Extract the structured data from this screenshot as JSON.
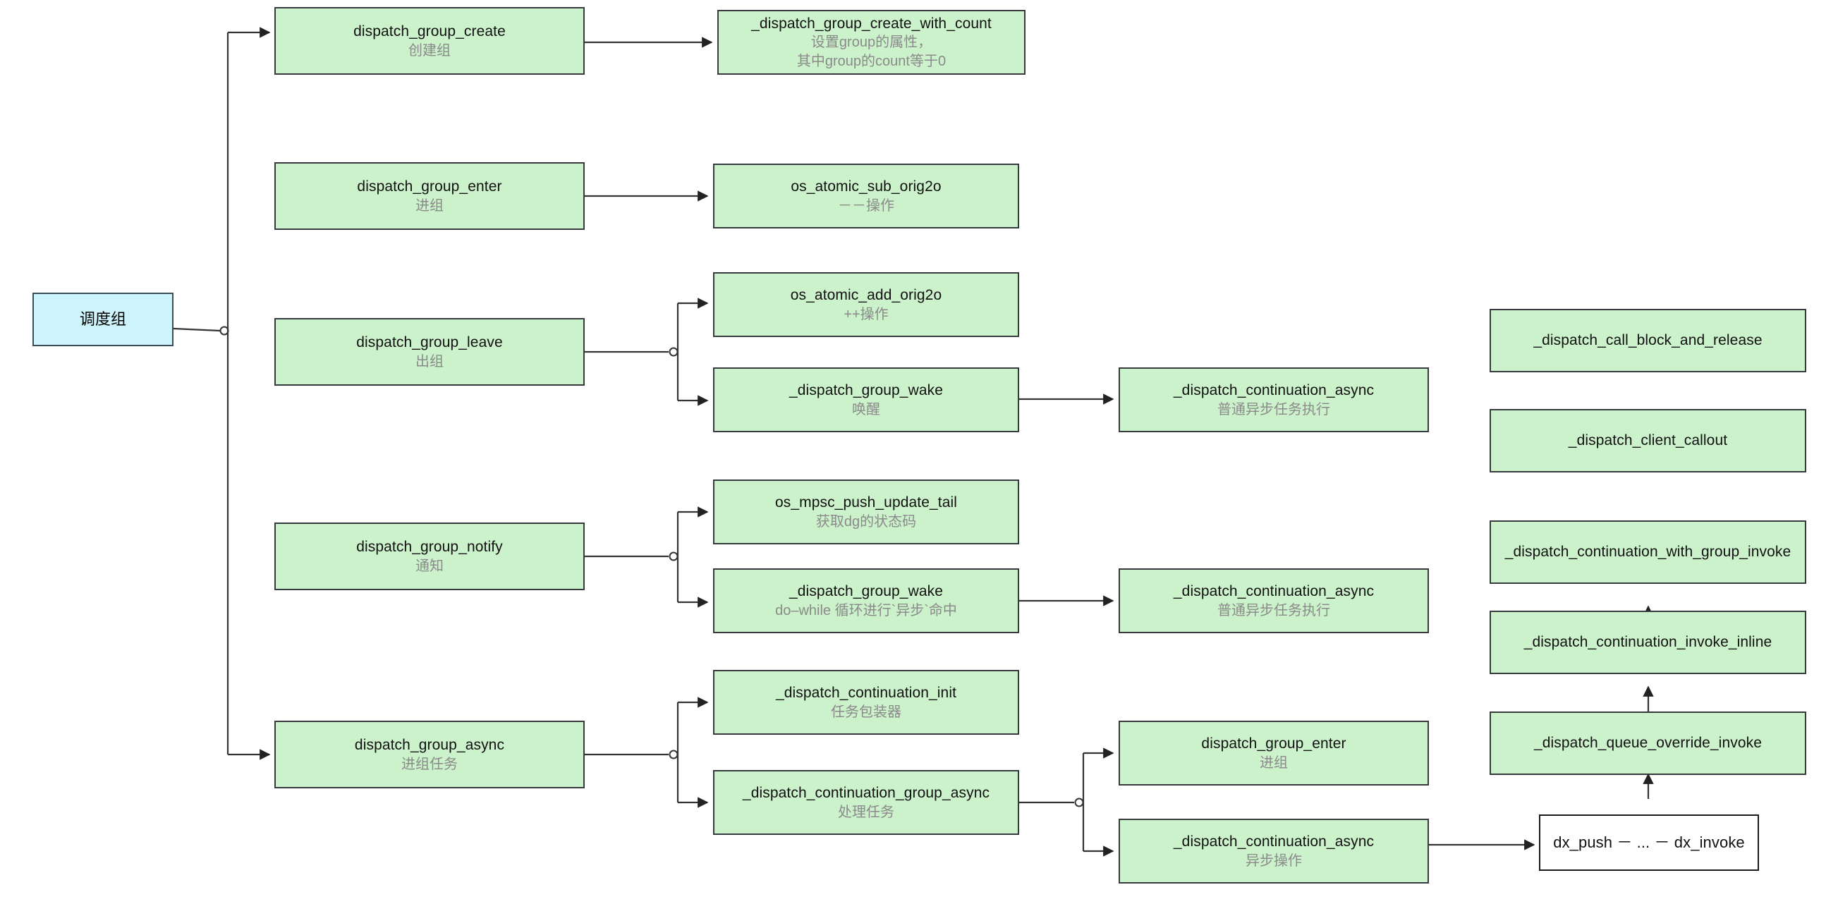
{
  "diagram": {
    "title": "dispatch group call flow",
    "colors": {
      "node_fill": "#ccf2cc",
      "node_border": "#36393d",
      "root_fill": "#cdf4fb",
      "plain_fill": "#ffffff",
      "edge": "#333333",
      "title_text": "#111111",
      "sub_text": "#8a8a8a",
      "background": "#ffffff"
    }
  },
  "nodes": {
    "root": {
      "title": "调度组",
      "sub": ""
    },
    "group_create": {
      "title": "dispatch_group_create",
      "sub": "创建组"
    },
    "create_with_count": {
      "title": "_dispatch_group_create_with_count",
      "sub": "设置group的属性，",
      "sub2": "其中group的count等于0"
    },
    "group_enter": {
      "title": "dispatch_group_enter",
      "sub": "进组"
    },
    "atomic_sub": {
      "title": "os_atomic_sub_orig2o",
      "sub": "－－操作"
    },
    "group_leave": {
      "title": "dispatch_group_leave",
      "sub": "出组"
    },
    "atomic_add": {
      "title": "os_atomic_add_orig2o",
      "sub": "++操作"
    },
    "group_wake_leave": {
      "title": "_dispatch_group_wake",
      "sub": "唤醒"
    },
    "continuation_async_leave": {
      "title": "_dispatch_continuation_async",
      "sub": "普通异步任务执行"
    },
    "group_notify": {
      "title": "dispatch_group_notify",
      "sub": "通知"
    },
    "mpsc_push": {
      "title": "os_mpsc_push_update_tail",
      "sub": "获取dg的状态码"
    },
    "group_wake_notify": {
      "title": "_dispatch_group_wake",
      "sub": "do–while 循环进行`异步`命中"
    },
    "continuation_async_notify": {
      "title": "_dispatch_continuation_async",
      "sub": "普通异步任务执行"
    },
    "group_async": {
      "title": "dispatch_group_async",
      "sub": "进组任务"
    },
    "continuation_init": {
      "title": "_dispatch_continuation_init",
      "sub": "任务包装器"
    },
    "continuation_group_async": {
      "title": "_dispatch_continuation_group_async",
      "sub": "处理任务"
    },
    "group_enter_2": {
      "title": "dispatch_group_enter",
      "sub": "进组"
    },
    "continuation_async_step": {
      "title": "_dispatch_continuation_async",
      "sub": "异步操作"
    },
    "dx_push": {
      "title": "dx_push － ... － dx_invoke",
      "sub": ""
    },
    "queue_override_invoke": {
      "title": "_dispatch_queue_override_invoke",
      "sub": ""
    },
    "continuation_invoke_inline": {
      "title": "_dispatch_continuation_invoke_inline",
      "sub": ""
    },
    "continuation_with_group_invoke": {
      "title": "_dispatch_continuation_with_group_invoke",
      "sub": ""
    },
    "client_callout": {
      "title": "_dispatch_client_callout",
      "sub": ""
    },
    "call_block_and_release": {
      "title": "_dispatch_call_block_and_release",
      "sub": ""
    }
  }
}
